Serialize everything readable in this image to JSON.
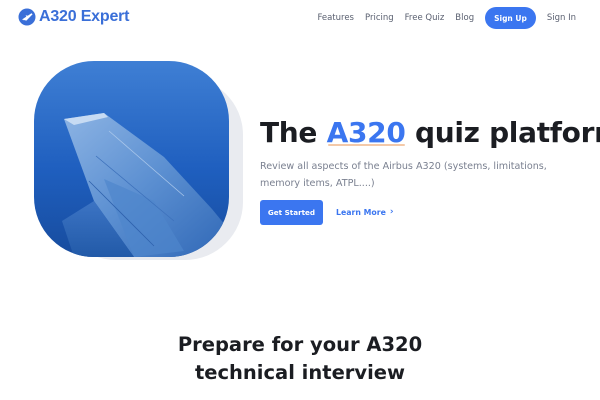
{
  "brand": {
    "name": "A320 Expert",
    "accent": "#3b76f0",
    "logo_icon": "airplane-badge-icon"
  },
  "nav": {
    "links": [
      "Features",
      "Pricing",
      "Free Quiz",
      "Blog"
    ],
    "signup_label": "Sign Up",
    "signin_label": "Sign In"
  },
  "hero": {
    "image": "airplane-wing-over-sea",
    "title_before": "The ",
    "title_highlight": "A320",
    "title_after": " quiz platform",
    "subtitle": "Review all aspects of the Airbus A320 (systems, limitations, memory items, ATPL....)",
    "cta_label": "Get Started",
    "learn_label": "Learn More",
    "learn_icon": "chevron-right-icon"
  },
  "section": {
    "title_line1": "Prepare for your A320",
    "title_line2": "technical interview"
  }
}
